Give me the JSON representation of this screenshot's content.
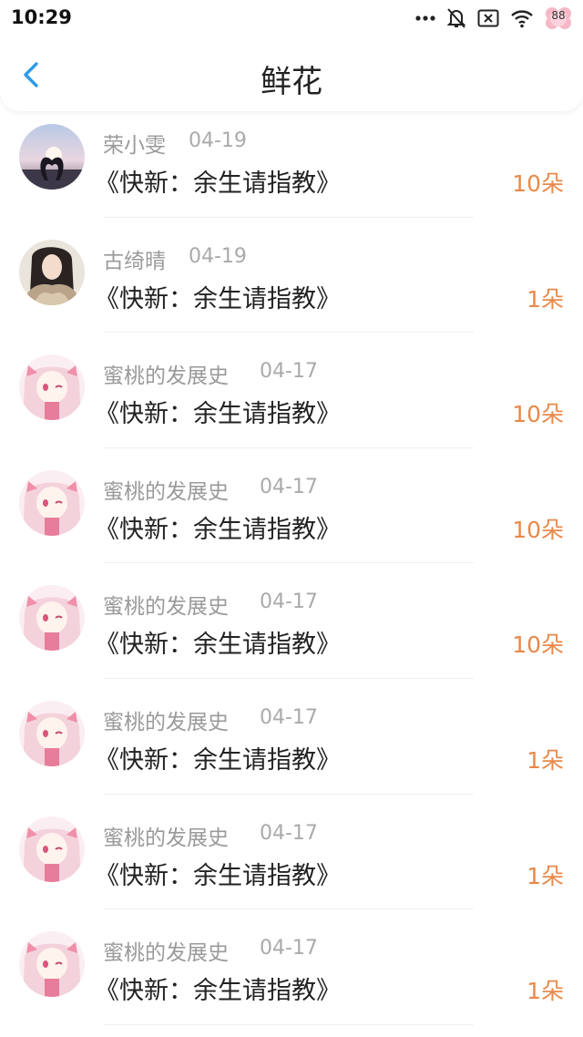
{
  "status_bar": {
    "time": "10:29",
    "battery": "88",
    "icons": [
      "more-dots-icon",
      "bell-muted-icon",
      "sim-x-icon",
      "wifi-icon",
      "battery-icon"
    ]
  },
  "header": {
    "title": "鲜花",
    "back_icon": "chevron-left-icon",
    "accent_color": "#2e9be6"
  },
  "items": [
    {
      "user": "荣小雯",
      "date": "04-19",
      "title": "《快新：余生请指教》",
      "count": "10朵",
      "avatar": "crowd-heart"
    },
    {
      "user": "古绮晴",
      "date": "04-19",
      "title": "《快新：余生请指教》",
      "count": "1朵",
      "avatar": "girl-photo"
    },
    {
      "user": "蜜桃的发展史",
      "date": "04-17",
      "title": "《快新：余生请指教》",
      "count": "10朵",
      "avatar": "anime-girl"
    },
    {
      "user": "蜜桃的发展史",
      "date": "04-17",
      "title": "《快新：余生请指教》",
      "count": "10朵",
      "avatar": "anime-girl"
    },
    {
      "user": "蜜桃的发展史",
      "date": "04-17",
      "title": "《快新：余生请指教》",
      "count": "10朵",
      "avatar": "anime-girl"
    },
    {
      "user": "蜜桃的发展史",
      "date": "04-17",
      "title": "《快新：余生请指教》",
      "count": "1朵",
      "avatar": "anime-girl"
    },
    {
      "user": "蜜桃的发展史",
      "date": "04-17",
      "title": "《快新：余生请指教》",
      "count": "1朵",
      "avatar": "anime-girl"
    },
    {
      "user": "蜜桃的发展史",
      "date": "04-17",
      "title": "《快新：余生请指教》",
      "count": "1朵",
      "avatar": "anime-girl"
    }
  ],
  "colors": {
    "count": "#e8894a",
    "meta": "#9a9a9a"
  }
}
